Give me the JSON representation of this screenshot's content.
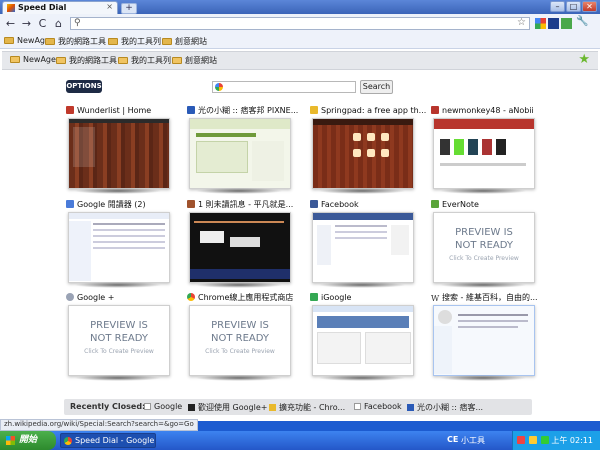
{
  "browser": {
    "tab_title": "Speed Dial",
    "tab_close": "×",
    "new_tab": "+",
    "win_min": "–",
    "win_max": "□",
    "win_close": "✕",
    "back": "←",
    "forward": "→",
    "reload": "C",
    "home": "⌂",
    "search_glyph": "⚲",
    "star_glyph": "☆",
    "wrench_glyph": "🔧",
    "url": ""
  },
  "bookmarks_bar": [
    "NewAge",
    "我的網路工具",
    "我的工具列",
    "創意網站"
  ],
  "speed_dial": {
    "folders": [
      "NewAge",
      "我的網路工具",
      "我的工具列",
      "創意網站"
    ],
    "options_label": "OPTIONS",
    "search_button": "Search",
    "search_value": "",
    "preview_line1": "PREVIEW IS",
    "preview_line2": "NOT READY",
    "preview_hint": "Click To Create Preview",
    "tiles": [
      {
        "title": "Wunderlist | Home",
        "icon": "wunderlist-icon",
        "color": "#c0392b"
      },
      {
        "title": "光の小糊 :: 痞客邦 PIXNE...",
        "icon": "pixnet-icon",
        "color": "#2a5ab7"
      },
      {
        "title": "Springpad: a free app th...",
        "icon": "springpad-icon",
        "color": "#e9b92c"
      },
      {
        "title": "newmonkey48 - aNobii",
        "icon": "anobii-icon",
        "color": "#b8352d"
      },
      {
        "title": "Google 閱讀器 (2)",
        "icon": "google-reader-icon",
        "color": "#4a7bd9"
      },
      {
        "title": "1 則未讀訊息 - 平凡就是...",
        "icon": "plurk-icon",
        "color": "#a0522d"
      },
      {
        "title": "Facebook",
        "icon": "facebook-icon",
        "color": "#3b5998"
      },
      {
        "title": "EverNote",
        "icon": "evernote-icon",
        "color": "#5aa43a"
      },
      {
        "title": "Google +",
        "icon": "google-plus-icon",
        "color": "#9aa3b5"
      },
      {
        "title": "Chrome線上應用程式商店",
        "icon": "chrome-store-icon",
        "color": "#e94235"
      },
      {
        "title": "iGoogle",
        "icon": "igoogle-icon",
        "color": "#34a853"
      },
      {
        "title": "搜索 - 維基百科，自由的...",
        "icon": "wikipedia-icon",
        "color": "#333333"
      }
    ],
    "recently_closed_label": "Recently Closed:",
    "recently_closed": [
      {
        "title": "Google",
        "icon": "page-icon",
        "color": "#dddddd"
      },
      {
        "title": "歡迎使用 Google+",
        "icon": "google-plus-icon",
        "color": "#222222"
      },
      {
        "title": "擴充功能 - Chro...",
        "icon": "extension-icon",
        "color": "#e9b92c"
      },
      {
        "title": "Facebook",
        "icon": "page-icon",
        "color": "#dddddd"
      },
      {
        "title": "光の小糊 :: 痞客...",
        "icon": "pixnet-icon",
        "color": "#2a5ab7"
      }
    ]
  },
  "status_bar": "zh.wikipedia.org/wiki/Special:Search?search=&go=Go",
  "taskbar": {
    "start": "開始",
    "task_item": "Speed Dial - Google C...",
    "ime": "CE",
    "toolbar_label": "小工具",
    "clock": "上午 02:11"
  }
}
